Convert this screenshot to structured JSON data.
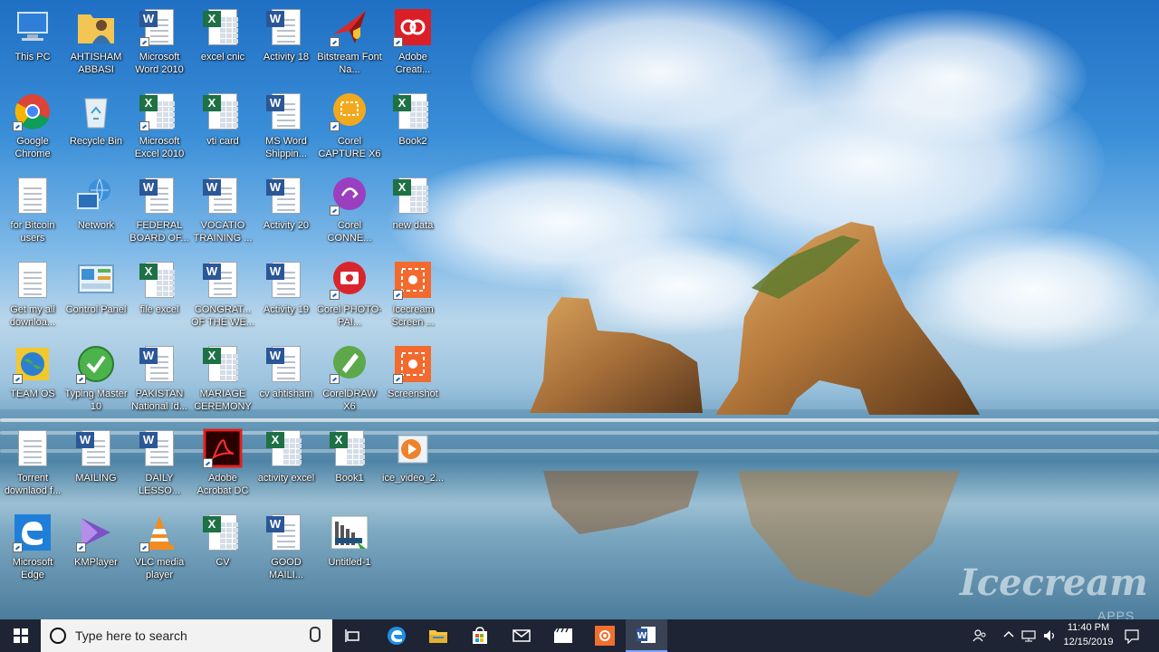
{
  "desktop": {
    "icons": [
      {
        "label": "This PC",
        "kind": "pc"
      },
      {
        "label": "AHTISHAM ABBASI",
        "kind": "user-folder"
      },
      {
        "label": "Microsoft Word 2010",
        "kind": "word-app"
      },
      {
        "label": "excel cnic",
        "kind": "excel"
      },
      {
        "label": "Activity 18",
        "kind": "word"
      },
      {
        "label": "Bitstream Font Na...",
        "kind": "bitstream"
      },
      {
        "label": "Adobe Creati...",
        "kind": "adobe-cc"
      },
      {
        "label": "Google Chrome",
        "kind": "chrome"
      },
      {
        "label": "Recycle Bin",
        "kind": "recycle"
      },
      {
        "label": "Microsoft Excel 2010",
        "kind": "excel-app"
      },
      {
        "label": "vti card",
        "kind": "excel"
      },
      {
        "label": "MS Word Shippin...",
        "kind": "word"
      },
      {
        "label": "Corel CAPTURE X6",
        "kind": "corel-capture"
      },
      {
        "label": "Book2",
        "kind": "excel"
      },
      {
        "label": "for Bitcoin users",
        "kind": "text"
      },
      {
        "label": "Network",
        "kind": "network"
      },
      {
        "label": "FEDERAL BOARD OF...",
        "kind": "word"
      },
      {
        "label": "VOCATIO TRAINING ...",
        "kind": "word"
      },
      {
        "label": "Activity 20",
        "kind": "word"
      },
      {
        "label": "Corel CONNE...",
        "kind": "corel-connect"
      },
      {
        "label": "new data",
        "kind": "excel"
      },
      {
        "label": "Get my all downloa...",
        "kind": "text"
      },
      {
        "label": "Control Panel",
        "kind": "control-panel"
      },
      {
        "label": "file excel",
        "kind": "excel"
      },
      {
        "label": "CONGRAT... OF THE WE...",
        "kind": "word"
      },
      {
        "label": "Activity 19",
        "kind": "word"
      },
      {
        "label": "Corel PHOTO-PAI...",
        "kind": "corel-photo"
      },
      {
        "label": "Icecream Screen ...",
        "kind": "icecream"
      },
      {
        "label": "TEAM OS",
        "kind": "teamos"
      },
      {
        "label": "Typing Master 10",
        "kind": "typing"
      },
      {
        "label": "PAKISTAN National Id...",
        "kind": "word"
      },
      {
        "label": "MARIAGE CEREMONY",
        "kind": "excel"
      },
      {
        "label": "cv ahtisham",
        "kind": "word"
      },
      {
        "label": "CorelDRAW X6",
        "kind": "coreldraw"
      },
      {
        "label": "Screenshot",
        "kind": "icecream"
      },
      {
        "label": "Torrent downlaod f...",
        "kind": "text"
      },
      {
        "label": "MAILING",
        "kind": "word"
      },
      {
        "label": "DAILY LESSO...",
        "kind": "word"
      },
      {
        "label": "Adobe Acrobat DC",
        "kind": "acrobat"
      },
      {
        "label": "activity excel",
        "kind": "excel"
      },
      {
        "label": "Book1",
        "kind": "excel"
      },
      {
        "label": "ice_video_2...",
        "kind": "video"
      },
      {
        "label": "Microsoft Edge",
        "kind": "edge"
      },
      {
        "label": "KMPlayer",
        "kind": "kmplayer"
      },
      {
        "label": "VLC media player",
        "kind": "vlc"
      },
      {
        "label": "CV",
        "kind": "excel"
      },
      {
        "label": "GOOD MAILI...",
        "kind": "word"
      },
      {
        "label": "Untitled-1",
        "kind": "untitled"
      }
    ]
  },
  "taskbar": {
    "search_placeholder": "Type here to search",
    "pinned": [
      "task-view-icon",
      "edge-icon",
      "file-explorer-icon",
      "store-icon",
      "mail-icon",
      "video-editor-icon",
      "icecream-icon",
      "word-icon"
    ],
    "clock_time": "11:40 PM",
    "clock_date": "12/15/2019"
  },
  "watermark": {
    "text": "Icecream",
    "sub": "APPS"
  }
}
